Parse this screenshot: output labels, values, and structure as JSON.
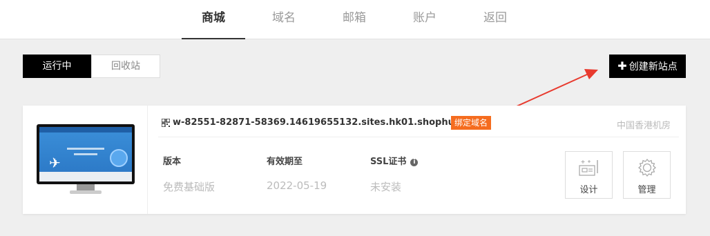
{
  "nav": {
    "tabs": [
      {
        "label": "商城",
        "active": true
      },
      {
        "label": "域名",
        "active": false
      },
      {
        "label": "邮箱",
        "active": false
      },
      {
        "label": "账户",
        "active": false
      },
      {
        "label": "返回",
        "active": false
      }
    ]
  },
  "filters": {
    "running": "运行中",
    "recycle": "回收站"
  },
  "create_button": "创建新站点",
  "site": {
    "domain": "w-82551-82871-58369.14619655132.sites.hk01.shophuyi.com",
    "bind_domain": "绑定域名",
    "location": "中国香港机房",
    "version_label": "版本",
    "version_value": "免费基础版",
    "expire_label": "有效期至",
    "expire_value": "2022-05-19",
    "ssl_label": "SSL证书",
    "ssl_value": "未安装",
    "actions": {
      "design": "设计",
      "manage": "管理"
    }
  },
  "colors": {
    "accent": "#f56c1f",
    "arrow": "#e83a2e"
  }
}
